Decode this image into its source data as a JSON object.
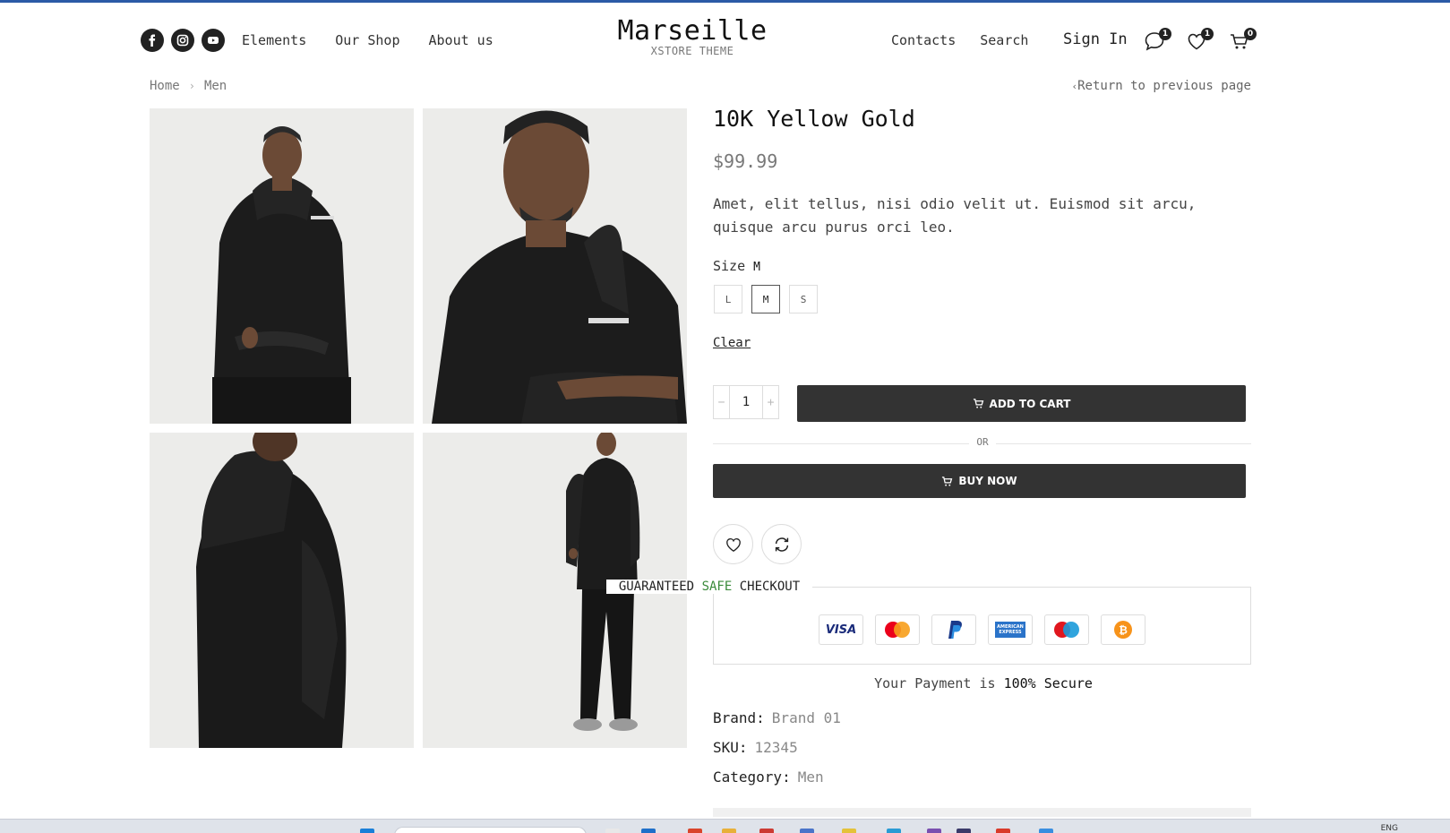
{
  "header": {
    "social": [
      {
        "name": "facebook-icon"
      },
      {
        "name": "instagram-icon"
      },
      {
        "name": "youtube-icon"
      }
    ],
    "nav_left": [
      "Elements",
      "Our Shop",
      "About us"
    ],
    "logo_title": "Marseille",
    "logo_subtitle": "XSTORE THEME",
    "nav_right": [
      "Contacts",
      "Search"
    ],
    "sign_in": "Sign In",
    "chat_count": "1",
    "wishlist_count": "1",
    "cart_count": "0"
  },
  "breadcrumb": {
    "items": [
      "Home",
      "Men"
    ],
    "return_link": "Return to previous page"
  },
  "product": {
    "title": "10K Yellow Gold",
    "price": "$99.99",
    "description": "Amet, elit tellus, nisi odio velit ut. Euismod sit arcu, quisque arcu purus orci leo.",
    "size_label": "Size",
    "size_selected": "M",
    "sizes": [
      "L",
      "M",
      "S"
    ],
    "clear": "Clear",
    "quantity": "1",
    "add_to_cart": "ADD TO CART",
    "or": "OR",
    "buy_now": "BUY NOW"
  },
  "checkout": {
    "title_pre": "GUARANTEED",
    "title_hl": "SAFE",
    "title_post": "CHECKOUT",
    "highlight_color": "#3a8a3a",
    "payment_cards": [
      "visa",
      "mastercard",
      "paypal",
      "american-express",
      "maestro",
      "bitcoin"
    ],
    "visa_label": "VISA",
    "amex_label": "AMERICAN EXPRESS",
    "secure_pre": "Your Payment is",
    "secure_bold": "100% Secure"
  },
  "meta": {
    "brand_label": "Brand:",
    "brand_value": "Brand 01",
    "sku_label": "SKU:",
    "sku_value": "12345",
    "category_label": "Category:",
    "category_value": "Men"
  },
  "taskbar": {
    "language": "ENG"
  }
}
